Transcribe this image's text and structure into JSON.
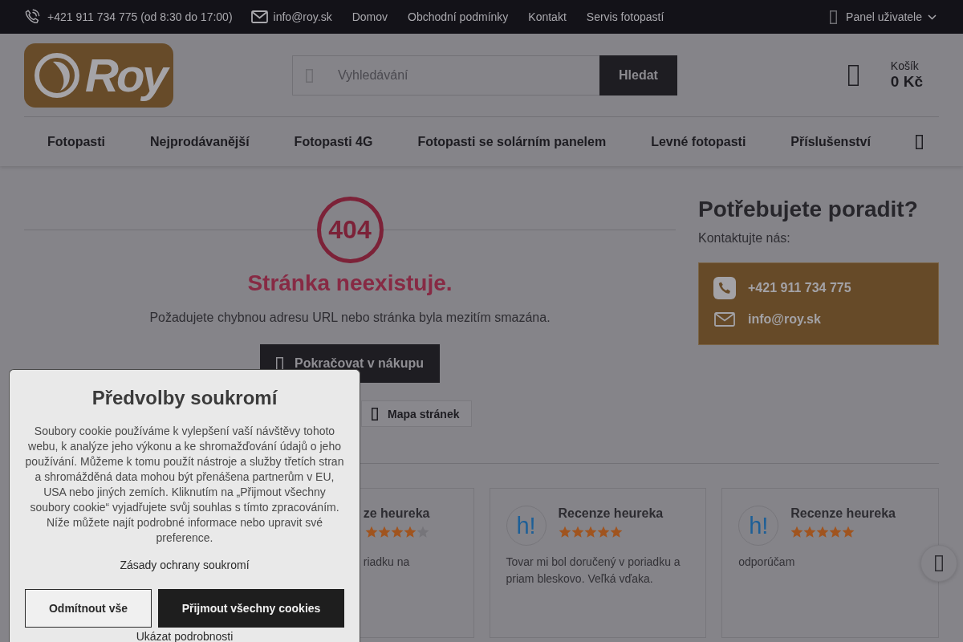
{
  "top_bar": {
    "phone": "+421 911 734 775 (od 8:30 do 17:00)",
    "email": "info@roy.sk",
    "links": [
      "Domov",
      "Obchodní podmínky",
      "Kontakt",
      "Servis fotopastí"
    ],
    "user_panel": "Panel uživatele"
  },
  "header": {
    "logo": "Roy",
    "search": {
      "placeholder": "Vyhledávání",
      "button": "Hledat"
    },
    "cart": {
      "label": "Košík",
      "total": "0 Kč"
    }
  },
  "nav": {
    "items": [
      "Fotopasti",
      "Nejprodávanější",
      "Fotopasti 4G",
      "Fotopasti se solárním panelem",
      "Levné fotopasti",
      "Příslušenství"
    ]
  },
  "error": {
    "code": "404",
    "title": "Stránka neexistuje.",
    "message": "Požadujete chybnou adresu URL nebo stránka byla mezitím smazána.",
    "button": "Pokračovat v nákupu",
    "links": [
      "Mapa stránek"
    ]
  },
  "help": {
    "title": "Potřebujete poradit?",
    "subtitle": "Kontaktujte nás:",
    "contacts": [
      {
        "kind": "phone",
        "text": "+421 911 734 775"
      },
      {
        "kind": "email",
        "text": "info@roy.sk"
      }
    ]
  },
  "reviews": [
    {
      "kind": "partial",
      "title": "ze heureka",
      "stars": 4,
      "text": "riadku na"
    },
    {
      "kind": "full",
      "logo": "h!",
      "title": "Recenze heureka",
      "stars": 5,
      "text": "Tovar mi bol doručený v poriadku a priam bleskovo. Veľká vďaka."
    },
    {
      "kind": "full",
      "logo": "h!",
      "title": "Recenze heureka",
      "stars": 5,
      "text": "odporúčam"
    }
  ],
  "cookie_dialog": {
    "title": "Předvolby soukromí",
    "text": "Soubory cookie používáme k vylepšení vaší návštěvy tohoto webu, k analýze jeho výkonu a ke shromažďování údajů o jeho používání. Můžeme k tomu použít nástroje a služby třetích stran a shromážděná data mohou být přenášena partnerům v EU, USA nebo jiných zemích. Kliknutím na „Přijmout všechny soubory cookie“ vyjadřujete svůj souhlas s tímto zpracováním. Níže můžete najít podrobné informace nebo upravit své preference.",
    "policy_link": "Zásady ochrany soukromí",
    "buttons": [
      {
        "kind": "reject",
        "label": "Odmítnout vše"
      },
      {
        "kind": "accept",
        "label": "Přijmout všechny cookies"
      }
    ],
    "details_link": "Ukázat podrobnosti"
  }
}
